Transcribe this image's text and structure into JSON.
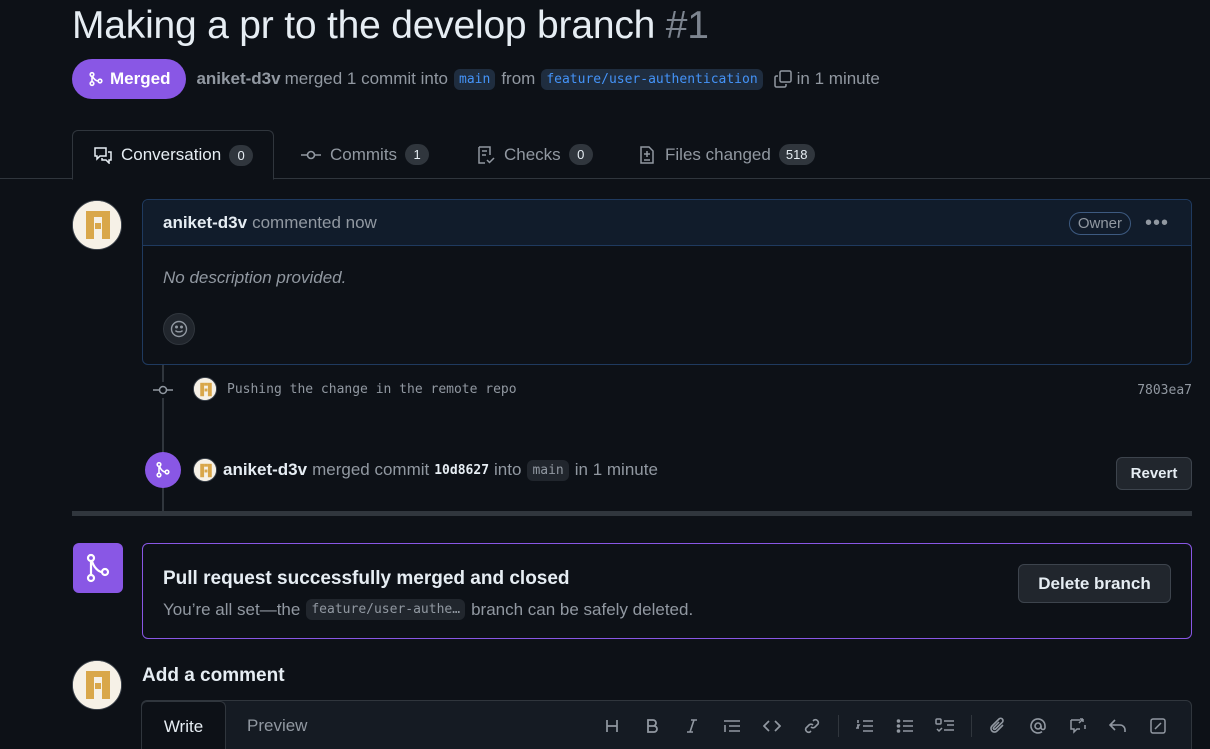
{
  "pr": {
    "title": "Making a pr to the develop branch",
    "number": "#1",
    "status": "Merged",
    "author": "aniket-d3v",
    "merge_text": "merged 1 commit into",
    "base_branch": "main",
    "from_text": "from",
    "head_branch": "feature/user-authentication",
    "time_text": "in 1 minute"
  },
  "tabs": [
    {
      "label": "Conversation",
      "count": "0"
    },
    {
      "label": "Commits",
      "count": "1"
    },
    {
      "label": "Checks",
      "count": "0"
    },
    {
      "label": "Files changed",
      "count": "518"
    }
  ],
  "comment": {
    "author": "aniket-d3v",
    "action": "commented now",
    "role_badge": "Owner",
    "body": "No description provided."
  },
  "timeline": {
    "commit_message": "Pushing the change in the remote repo",
    "commit_sha": "7803ea7",
    "merge_author": "aniket-d3v",
    "merge_action": "merged commit",
    "merge_sha": "10d8627",
    "merge_into": "into",
    "merge_branch": "main",
    "merge_time": "in 1 minute",
    "revert_label": "Revert"
  },
  "merged_box": {
    "title": "Pull request successfully merged and closed",
    "subtitle_pre": "You’re all set—the",
    "branch_short": "feature/user-authe…",
    "subtitle_post": "branch can be safely deleted.",
    "delete_label": "Delete branch"
  },
  "add_comment": {
    "title": "Add a comment",
    "write_tab": "Write",
    "preview_tab": "Preview",
    "toolbar_icons": [
      "heading-icon",
      "bold-icon",
      "italic-icon",
      "quote-icon",
      "code-icon",
      "link-icon",
      "numbered-list-icon",
      "unordered-list-icon",
      "task-list-icon",
      "attach-icon",
      "mention-icon",
      "reference-icon",
      "reply-icon",
      "slash-command-icon"
    ]
  },
  "colors": {
    "background": "#0d1117",
    "merged_purple": "#8957e5",
    "link_blue": "#4493f8",
    "border": "#30363d"
  }
}
